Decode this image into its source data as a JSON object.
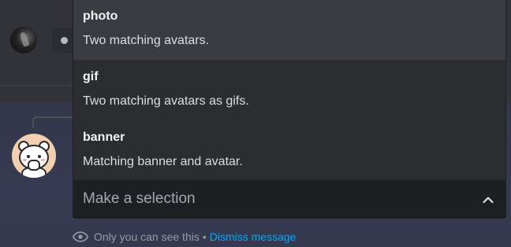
{
  "select_menu": {
    "placeholder": "Make a selection",
    "options": [
      {
        "label": "photo",
        "description": "Two matching avatars."
      },
      {
        "label": "gif",
        "description": "Two matching avatars as gifs."
      },
      {
        "label": "banner",
        "description": "Matching banner and avatar."
      }
    ]
  },
  "ephemeral_note": {
    "text": "Only you can see this",
    "separator": "•",
    "dismiss_label": "Dismiss message"
  },
  "icons": {
    "eye": "eye-icon",
    "chevron": "chevron-up-icon"
  },
  "colors": {
    "link": "#00a8fc",
    "menu_bg": "#2b2d31",
    "option_hover": "#393c41",
    "select_bg": "#1e1f22"
  }
}
